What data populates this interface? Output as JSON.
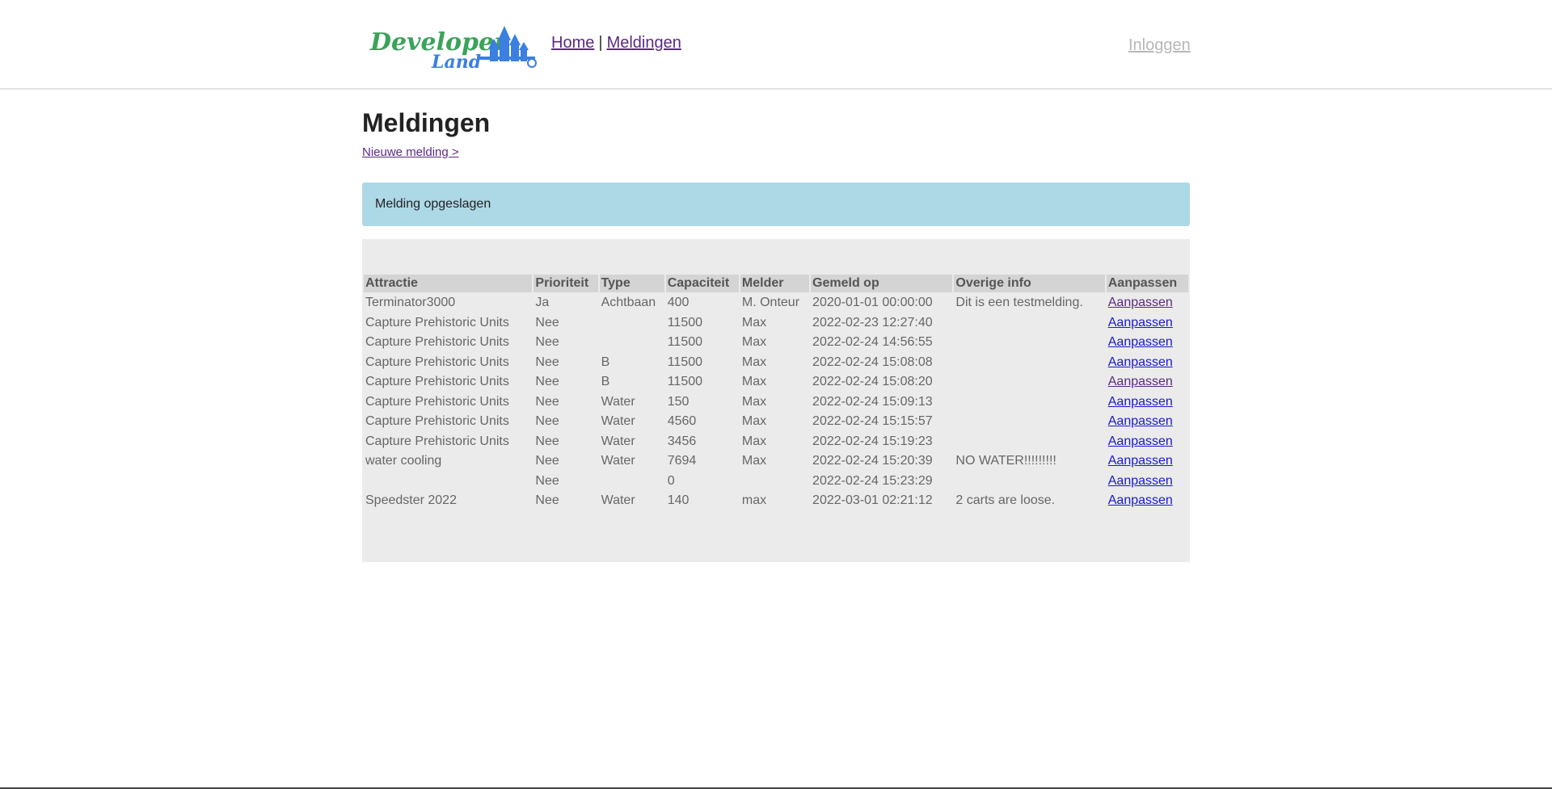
{
  "header": {
    "logo_text_top": "Developer",
    "logo_text_bottom": "Land",
    "nav": {
      "home": "Home",
      "separator": "|",
      "meldingen": "Meldingen"
    },
    "login": "Inloggen"
  },
  "page": {
    "title": "Meldingen",
    "new_link": "Nieuwe melding >",
    "alert": "Melding opgeslagen"
  },
  "table": {
    "columns": [
      "Attractie",
      "Prioriteit",
      "Type",
      "Capaciteit",
      "Melder",
      "Gemeld op",
      "Overige info",
      "Aanpassen"
    ],
    "rows": [
      [
        "Terminator3000",
        "Ja",
        "Achtbaan",
        "400",
        "M. Onteur",
        "2020-01-01 00:00:00",
        "Dit is een testmelding.",
        "Aanpassen"
      ],
      [
        "Capture Prehistoric Units",
        "Nee",
        "",
        "11500",
        "Max",
        "2022-02-23 12:27:40",
        "",
        "Aanpassen"
      ],
      [
        "Capture Prehistoric Units",
        "Nee",
        "",
        "11500",
        "Max",
        "2022-02-24 14:56:55",
        "",
        "Aanpassen"
      ],
      [
        "Capture Prehistoric Units",
        "Nee",
        "B",
        "11500",
        "Max",
        "2022-02-24 15:08:08",
        "",
        "Aanpassen"
      ],
      [
        "Capture Prehistoric Units",
        "Nee",
        "B",
        "11500",
        "Max",
        "2022-02-24 15:08:20",
        "",
        "Aanpassen"
      ],
      [
        "Capture Prehistoric Units",
        "Nee",
        "Water",
        "150",
        "Max",
        "2022-02-24 15:09:13",
        "",
        "Aanpassen"
      ],
      [
        "Capture Prehistoric Units",
        "Nee",
        "Water",
        "4560",
        "Max",
        "2022-02-24 15:15:57",
        "",
        "Aanpassen"
      ],
      [
        "Capture Prehistoric Units",
        "Nee",
        "Water",
        "3456",
        "Max",
        "2022-02-24 15:19:23",
        "",
        "Aanpassen"
      ],
      [
        "water cooling",
        "Nee",
        "Water",
        "7694",
        "Max",
        "2022-02-24 15:20:39",
        "NO WATER!!!!!!!!!",
        "Aanpassen"
      ],
      [
        "",
        "Nee",
        "",
        "0",
        "",
        "2022-02-24 15:23:29",
        "",
        "Aanpassen"
      ],
      [
        "Speedster 2022",
        "Nee",
        "Water",
        "140",
        "max",
        "2022-03-01 02:21:12",
        "2 carts are loose.",
        "Aanpassen"
      ]
    ]
  },
  "colors": {
    "alert_bg": "#add8e6",
    "panel_bg": "#ebebeb",
    "header_cell_bg": "#d4d4d4",
    "link_visited": "#5a2a82",
    "link": "#1a1acc",
    "logo_green": "#3aa35a",
    "logo_blue": "#3b7fe0"
  }
}
